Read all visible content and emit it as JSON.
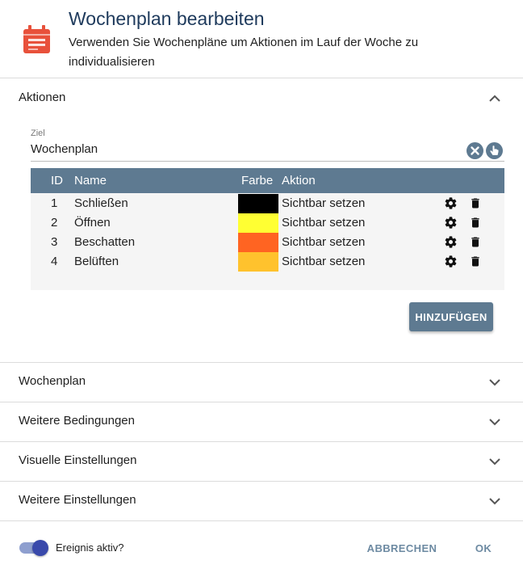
{
  "dialog": {
    "title": "Wochenplan bearbeiten",
    "subtitle": "Verwenden Sie Wochenpläne um Aktionen im Lauf der Woche zu individualisieren",
    "icon": "calendar-icon",
    "icon_color": "#e8513b"
  },
  "panels": {
    "actions": {
      "label": "Aktionen",
      "expanded": true
    },
    "weekplan": {
      "label": "Wochenplan"
    },
    "conditions": {
      "label": "Weitere Bedingungen"
    },
    "visual": {
      "label": "Visuelle Einstellungen"
    },
    "more": {
      "label": "Weitere Einstellungen"
    }
  },
  "target": {
    "label": "Ziel",
    "value": "Wochenplan"
  },
  "actions_table": {
    "headers": {
      "id": "ID",
      "name": "Name",
      "color": "Farbe",
      "action": "Aktion"
    },
    "rows": [
      {
        "id": "1",
        "name": "Schließen",
        "color": "#000000",
        "action": "Sichtbar setzen"
      },
      {
        "id": "2",
        "name": "Öffnen",
        "color": "#ffff33",
        "action": "Sichtbar setzen"
      },
      {
        "id": "3",
        "name": "Beschatten",
        "color": "#ff6422",
        "action": "Sichtbar setzen"
      },
      {
        "id": "4",
        "name": "Belüften",
        "color": "#ffc22d",
        "action": "Sichtbar setzen"
      }
    ],
    "add_label": "HINZUFÜGEN"
  },
  "footer": {
    "active_label": "Ereignis aktiv?",
    "active": true,
    "cancel_label": "ABBRECHEN",
    "ok_label": "OK"
  },
  "colors": {
    "primary": "#5e7a91",
    "title": "#1e3a5c",
    "toggle": "#3949ab"
  }
}
